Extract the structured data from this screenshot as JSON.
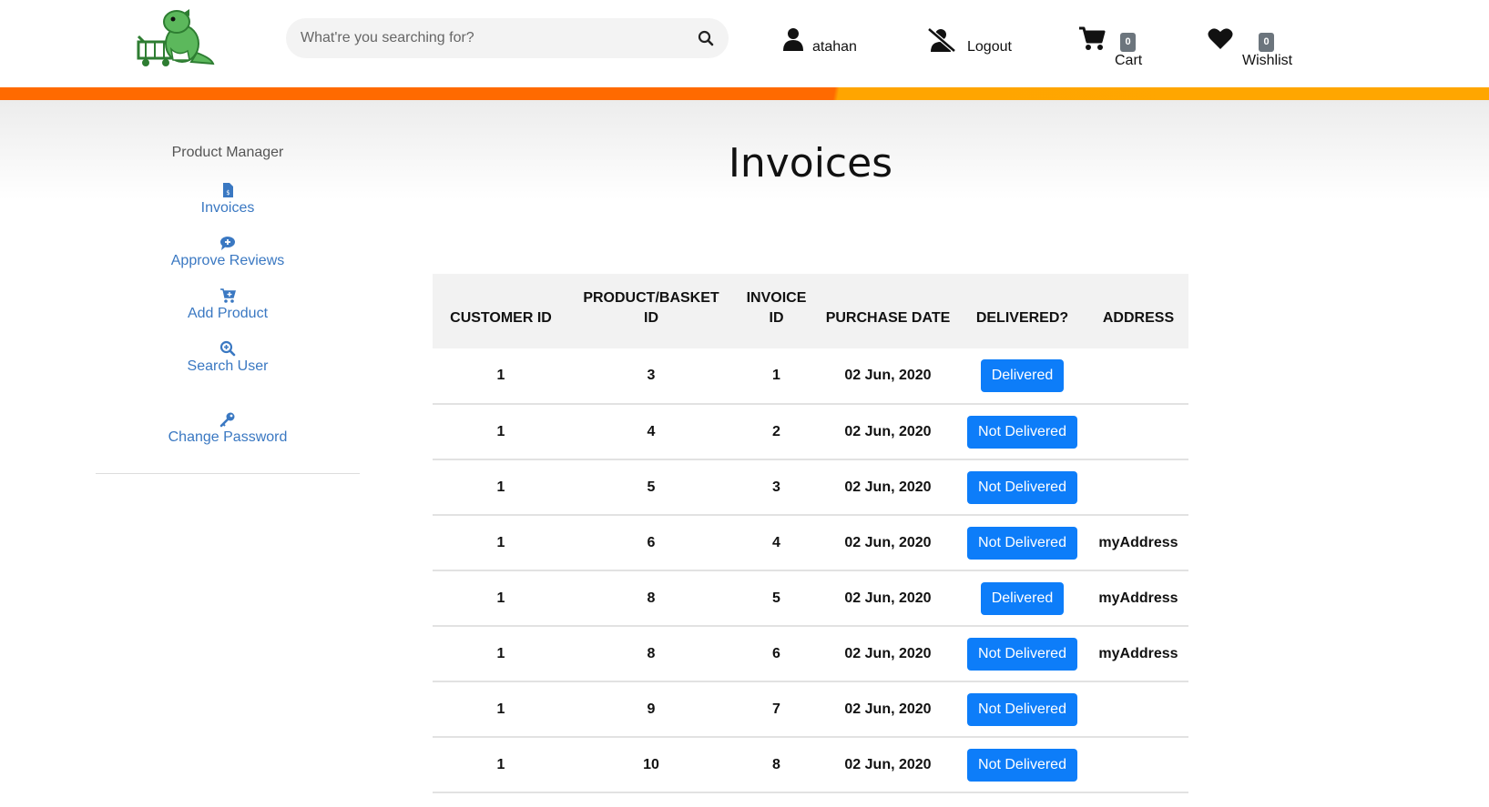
{
  "header": {
    "search_placeholder": "What're you searching for?",
    "username": "atahan",
    "logout_label": "Logout",
    "cart_label": "Cart",
    "cart_count": "0",
    "wishlist_label": "Wishlist",
    "wishlist_count": "0"
  },
  "colors": {
    "accent_orange": "#ff6a00",
    "accent_amber": "#ffa500",
    "button_blue": "#0d7df9",
    "link_blue": "#3a78c2"
  },
  "sidebar": {
    "title": "Product Manager",
    "items": [
      {
        "label": "Invoices",
        "icon": "file-invoice-icon"
      },
      {
        "label": "Approve Reviews",
        "icon": "comment-plus-icon"
      },
      {
        "label": "Add Product",
        "icon": "cart-plus-icon"
      },
      {
        "label": "Search User",
        "icon": "search-plus-icon"
      },
      {
        "label": "Change Password",
        "icon": "key-icon"
      }
    ]
  },
  "page": {
    "title": "Invoices"
  },
  "table": {
    "headers": [
      "CUSTOMER ID",
      "PRODUCT/BASKET ID",
      "INVOICE ID",
      "PURCHASE DATE",
      "DELIVERED?",
      "ADDRESS"
    ],
    "rows": [
      {
        "customer_id": "1",
        "product_id": "3",
        "invoice_id": "1",
        "date": "02 Jun, 2020",
        "status": "Delivered",
        "address": ""
      },
      {
        "customer_id": "1",
        "product_id": "4",
        "invoice_id": "2",
        "date": "02 Jun, 2020",
        "status": "Not Delivered",
        "address": ""
      },
      {
        "customer_id": "1",
        "product_id": "5",
        "invoice_id": "3",
        "date": "02 Jun, 2020",
        "status": "Not Delivered",
        "address": ""
      },
      {
        "customer_id": "1",
        "product_id": "6",
        "invoice_id": "4",
        "date": "02 Jun, 2020",
        "status": "Not Delivered",
        "address": "myAddress"
      },
      {
        "customer_id": "1",
        "product_id": "8",
        "invoice_id": "5",
        "date": "02 Jun, 2020",
        "status": "Delivered",
        "address": "myAddress"
      },
      {
        "customer_id": "1",
        "product_id": "8",
        "invoice_id": "6",
        "date": "02 Jun, 2020",
        "status": "Not Delivered",
        "address": "myAddress"
      },
      {
        "customer_id": "1",
        "product_id": "9",
        "invoice_id": "7",
        "date": "02 Jun, 2020",
        "status": "Not Delivered",
        "address": ""
      },
      {
        "customer_id": "1",
        "product_id": "10",
        "invoice_id": "8",
        "date": "02 Jun, 2020",
        "status": "Not Delivered",
        "address": ""
      }
    ]
  }
}
